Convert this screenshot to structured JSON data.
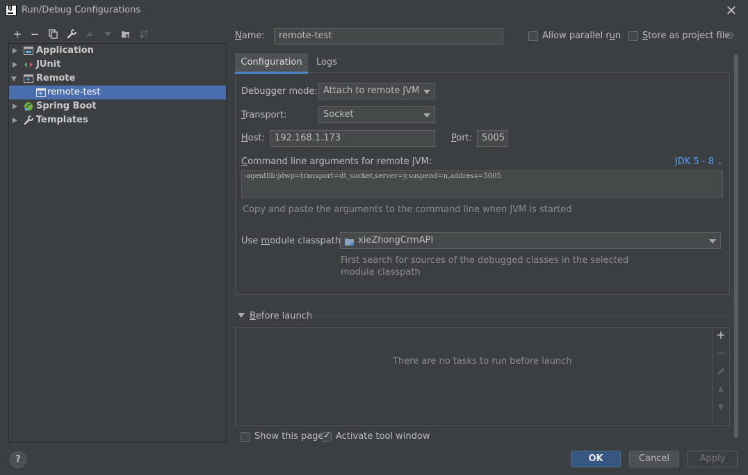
{
  "window": {
    "title": "Run/Debug Configurations",
    "close_glyph": "✕"
  },
  "toolbar": {
    "add": "+",
    "remove": "−",
    "icons": [
      "add-icon",
      "remove-icon",
      "copy-icon",
      "wrench-icon",
      "move-up-icon",
      "move-down-icon",
      "new-folder-icon",
      "sort-icon"
    ]
  },
  "tree": {
    "items": [
      {
        "label": "Application",
        "icon": "application-icon",
        "expanded": false
      },
      {
        "label": "JUnit",
        "icon": "junit-icon",
        "expanded": false
      },
      {
        "label": "Remote",
        "icon": "remote-icon",
        "expanded": true
      },
      {
        "label": "remote-test",
        "icon": "remote-config-icon",
        "selected": true
      },
      {
        "label": "Spring Boot",
        "icon": "spring-boot-icon",
        "expanded": false
      },
      {
        "label": "Templates",
        "icon": "wrench-icon",
        "expanded": false
      }
    ]
  },
  "form": {
    "name_label_u": "N",
    "name_label_rest": "ame:",
    "name_value": "remote-test",
    "allow_parallel_label_pre": "Allow parallel r",
    "allow_parallel_label_u": "u",
    "allow_parallel_label_post": "n",
    "allow_parallel_checked": false,
    "store_label_u": "S",
    "store_label_rest": "tore as project file",
    "store_checked": false
  },
  "tabs": {
    "configuration": "Configuration",
    "logs": "Logs"
  },
  "config": {
    "debugger_mode_label": "Debugger mode:",
    "debugger_mode_value": "Attach to remote JVM",
    "transport_label_u": "T",
    "transport_label_rest": "ransport:",
    "transport_value": "Socket",
    "host_label_u": "H",
    "host_label_rest": "ost:",
    "host_value": "192.168.1.173",
    "port_label_u": "P",
    "port_label_rest": "ort:",
    "port_value": "5005",
    "cmd_label_u": "C",
    "cmd_label_rest": "ommand line arguments for remote JVM:",
    "jdk_link": "JDK 5 - 8",
    "cmd_value": "-agentlib:jdwp=transport=dt_socket,server=y,suspend=n,address=5005",
    "cmd_hint": "Copy and paste the arguments to the command line when JVM is started",
    "classpath_label_pre": "Use ",
    "classpath_label_u": "m",
    "classpath_label_post": "odule classpath:",
    "classpath_value": "xieZhongCrmAPI",
    "classpath_hint_1": "First search for sources of the debugged classes in the selected",
    "classpath_hint_2": "module classpath"
  },
  "before_launch": {
    "title_u": "B",
    "title_rest": "efore launch",
    "empty_text": "There are no tasks to run before launch",
    "add": "+",
    "remove": "−",
    "up": "▲",
    "down": "▼"
  },
  "footer": {
    "show_page_label": "Show this page",
    "show_page_checked": false,
    "activate_label": "Activate tool window",
    "activate_checked": true,
    "help": "?",
    "ok": "OK",
    "cancel": "Cancel",
    "apply": "Apply"
  },
  "colors": {
    "background": "#3c3f41",
    "selection": "#4b6eaf",
    "accent": "#4a88c7",
    "link": "#589df6",
    "ok_button": "#365880"
  }
}
